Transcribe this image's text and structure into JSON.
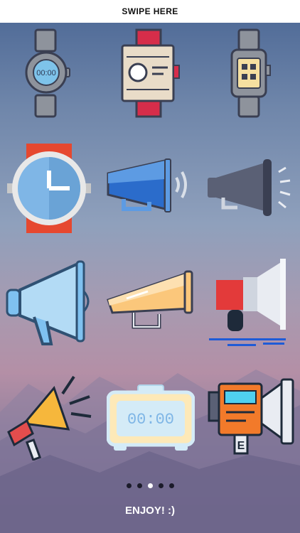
{
  "header": {
    "label": "SWIPE HERE"
  },
  "icons": [
    {
      "name": "wristwatch-digital-icon",
      "text": "00:00"
    },
    {
      "name": "wristwatch-square-icon"
    },
    {
      "name": "smartwatch-icon"
    },
    {
      "name": "wall-clock-icon"
    },
    {
      "name": "megaphone-sound-blue-icon"
    },
    {
      "name": "megaphone-grey-icon"
    },
    {
      "name": "megaphone-outline-icon"
    },
    {
      "name": "megaphone-yellow-icon"
    },
    {
      "name": "loudspeaker-red-icon"
    },
    {
      "name": "megaphone-orange-icon"
    },
    {
      "name": "alarm-clock-digital-icon",
      "text": "00:00"
    },
    {
      "name": "camera-megaphone-icon"
    }
  ],
  "pagination": {
    "count": 5,
    "active_index": 2
  },
  "footer": {
    "label": "ENJOY! :)"
  },
  "colors": {
    "background_top": "#4a6694",
    "background_bottom": "#6a6486",
    "header_bg": "#ffffff"
  }
}
